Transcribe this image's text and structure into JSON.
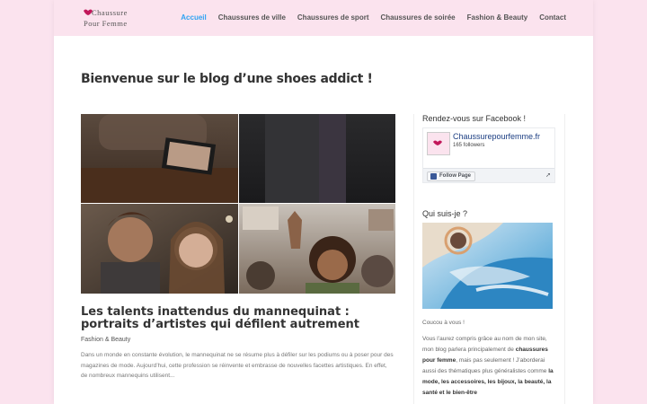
{
  "header": {
    "logo_line1": "Chaussure",
    "logo_line2": "Pour Femme",
    "nav": [
      {
        "label": "Accueil",
        "active": true
      },
      {
        "label": "Chaussures de ville",
        "active": false
      },
      {
        "label": "Chaussures de sport",
        "active": false
      },
      {
        "label": "Chaussures de soirée",
        "active": false
      },
      {
        "label": "Fashion & Beauty",
        "active": false
      },
      {
        "label": "Contact",
        "active": false
      }
    ]
  },
  "main": {
    "page_title": "Bienvenue sur le blog d’une shoes addict !",
    "article": {
      "title": "Les talents inattendus du mannequinat : portraits d’artistes qui défilent autrement",
      "category": "Fashion & Beauty",
      "excerpt": "Dans un monde en constante évolution, le mannequinat ne se résume plus à défiler sur les podiums ou à poser pour des magazines de mode. Aujourd’hui, cette profession se réinvente et embrasse de nouvelles facettes artistiques. En effet, de nombreux mannequins utilisent..."
    }
  },
  "sidebar": {
    "facebook": {
      "heading": "Rendez-vous sur Facebook !",
      "page_name": "Chaussurepourfemme.fr",
      "followers": "165 followers",
      "follow_label": "Follow Page",
      "share_icon": "share-icon"
    },
    "about": {
      "heading": "Qui suis-je ?",
      "greeting": "Coucou à vous !",
      "p1": "Vous l’aurez compris grâce au nom de mon site, mon blog parlera principalement de",
      "p1_bold": "chaussures pour femme",
      "p2": ", mais pas seulement ! J’aborderai aussi des thématiques plus généralistes comme",
      "p2_bold": "la mode, les accessoires, les bijoux, la beauté, la santé et le bien-être"
    }
  },
  "colors": {
    "background": "#fbe3ee",
    "accent": "#2ea3f2",
    "facebook_blue": "#3b5998"
  }
}
